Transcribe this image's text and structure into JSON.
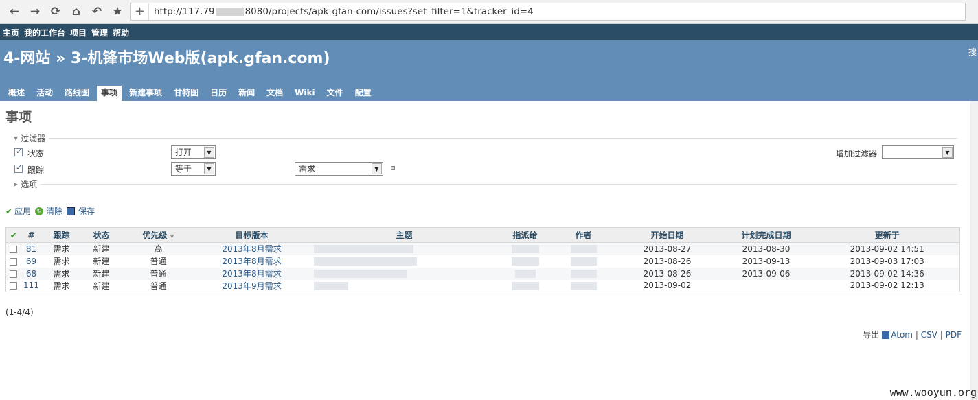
{
  "browser": {
    "url_prefix": "http://117.79",
    "url_suffix": "8080/projects/apk-gfan-com/issues?set_filter=1&tracker_id=4"
  },
  "top_menu": [
    "主页",
    "我的工作台",
    "项目",
    "管理",
    "帮助"
  ],
  "header": {
    "title": "4-网站 » 3-机锋市场Web版(apk.gfan.com)",
    "search_hint": "搜"
  },
  "tabs": [
    "概述",
    "活动",
    "路线图",
    "事项",
    "新建事项",
    "甘特图",
    "日历",
    "新闻",
    "文档",
    "Wiki",
    "文件",
    "配置"
  ],
  "page_title": "事项",
  "filters": {
    "legend": "过滤器",
    "rows": [
      {
        "label": "状态",
        "operator": "打开",
        "value": ""
      },
      {
        "label": "跟踪",
        "operator": "等于",
        "value": "需求"
      }
    ],
    "add_filter_label": "增加过滤器",
    "options_legend": "选项"
  },
  "actions": {
    "apply": "应用",
    "clear": "清除",
    "save": "保存"
  },
  "table": {
    "headers": {
      "id": "#",
      "tracker": "跟踪",
      "status": "状态",
      "priority": "优先级",
      "version": "目标版本",
      "subject": "主题",
      "assignee": "指派给",
      "author": "作者",
      "start": "开始日期",
      "due": "计划完成日期",
      "updated": "更新于"
    },
    "rows": [
      {
        "id": "81",
        "tracker": "需求",
        "status": "新建",
        "priority": "高",
        "version": "2013年8月需求",
        "start": "2013-08-27",
        "due": "2013-08-30",
        "updated": "2013-09-02 14:51"
      },
      {
        "id": "69",
        "tracker": "需求",
        "status": "新建",
        "priority": "普通",
        "version": "2013年8月需求",
        "start": "2013-08-26",
        "due": "2013-09-13",
        "updated": "2013-09-03 17:03"
      },
      {
        "id": "68",
        "tracker": "需求",
        "status": "新建",
        "priority": "普通",
        "version": "2013年8月需求",
        "start": "2013-08-26",
        "due": "2013-09-06",
        "updated": "2013-09-02 14:36"
      },
      {
        "id": "111",
        "tracker": "需求",
        "status": "新建",
        "priority": "普通",
        "version": "2013年9月需求",
        "start": "2013-09-02",
        "due": "",
        "updated": "2013-09-02 12:13"
      }
    ]
  },
  "pagination": "(1-4/4)",
  "export": {
    "label": "导出",
    "atom": "Atom",
    "csv": "CSV",
    "pdf": "PDF",
    "sep": "|"
  },
  "watermark": "www.wooyun.org"
}
